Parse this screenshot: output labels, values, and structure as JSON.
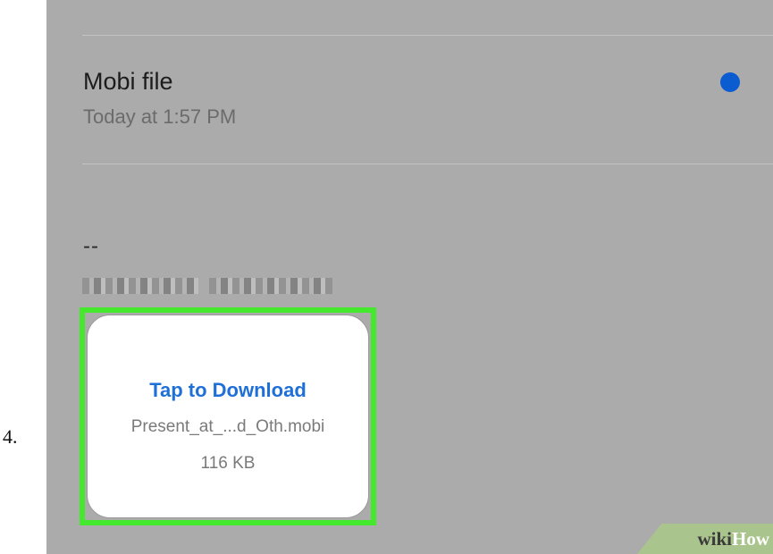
{
  "step": {
    "number": "4."
  },
  "message": {
    "subject": "Mobi file",
    "timestamp": "Today at 1:57 PM",
    "signature_separator": "--"
  },
  "attachment": {
    "action_label": "Tap to Download",
    "file_name": "Present_at_...d_Oth.mobi",
    "file_size": "116 KB"
  },
  "watermark": {
    "part1": "wiki",
    "part2": "How"
  },
  "colors": {
    "accent_blue": "#1f6fd8",
    "unread_dot": "#0b5bd1",
    "highlight_green": "#44e82d",
    "background_gray": "#ababab"
  },
  "icons": {
    "unread_indicator": "unread-dot-icon"
  }
}
